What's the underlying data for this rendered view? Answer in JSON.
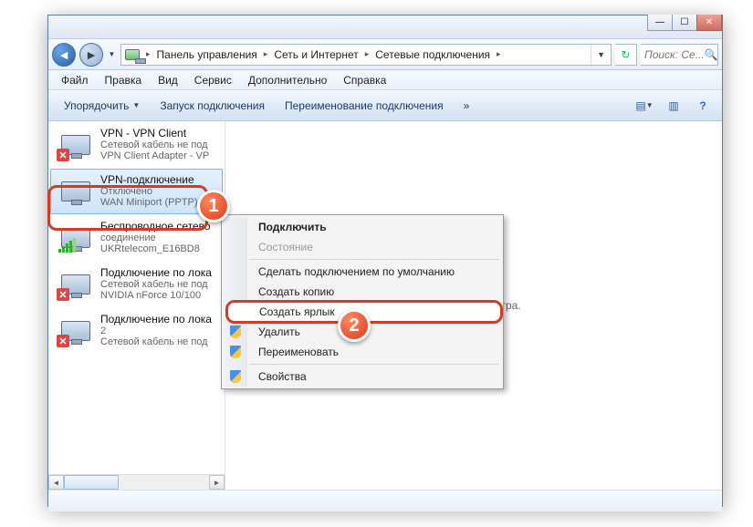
{
  "titlebar": {
    "min": "—",
    "max": "☐",
    "close": "✕"
  },
  "nav": {
    "back": "◄",
    "fwd": "►",
    "dd": "▼",
    "refresh": "↻",
    "breadcrumb": {
      "seg1": "Панель управления",
      "seg2": "Сеть и Интернет",
      "seg3": "Сетевые подключения",
      "arrow": "▸"
    },
    "search_placeholder": "Поиск: Се...",
    "search_icon": "🔍"
  },
  "menubar": {
    "file": "Файл",
    "edit": "Правка",
    "view": "Вид",
    "tools": "Сервис",
    "extra": "Дополнительно",
    "help": "Справка"
  },
  "toolbar": {
    "organize": "Упорядочить",
    "start": "Запуск подключения",
    "rename": "Переименование подключения",
    "overflow": "»",
    "dd": "▼",
    "view_icon": "▤",
    "preview_icon": "▥",
    "help_icon": "?"
  },
  "connections": [
    {
      "title": "VPN - VPN Client",
      "sub1": "Сетевой кабель не под",
      "sub2": "VPN Client Adapter - VP",
      "icon": "x"
    },
    {
      "title": "VPN-подключение",
      "sub1": "Отключено",
      "sub2": "WAN Miniport (PPTP)",
      "icon": "plain",
      "selected": true
    },
    {
      "title": "Беспроводное сетево",
      "sub1": "соединение",
      "sub2": "UKRtelecom_E16BD8",
      "icon": "wifi"
    },
    {
      "title": "Подключение по лока",
      "sub1": "Сетевой кабель не под",
      "sub2": "NVIDIA nForce 10/100",
      "icon": "x"
    },
    {
      "title": "Подключение по лока",
      "sub1": "2",
      "sub2": "Сетевой кабель не под",
      "icon": "x"
    }
  ],
  "main": {
    "placeholder": "льного просмотра."
  },
  "context_menu": {
    "connect": "Подключить",
    "status": "Состояние",
    "set_default": "Сделать подключением по умолчанию",
    "copy": "Создать копию",
    "shortcut": "Создать ярлык",
    "delete": "Удалить",
    "rename": "Переименовать",
    "properties": "Свойства"
  },
  "callouts": {
    "one": "1",
    "two": "2"
  },
  "scroll": {
    "left": "◄",
    "right": "►"
  }
}
